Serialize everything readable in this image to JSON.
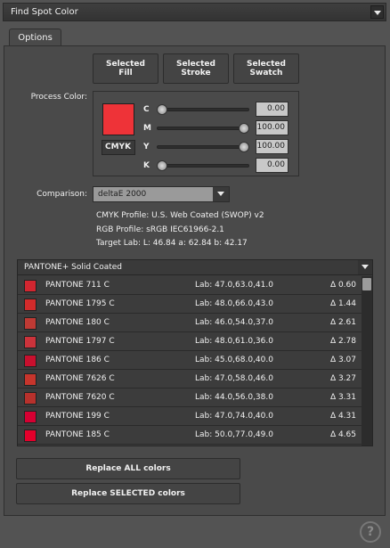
{
  "window": {
    "title": "Find Spot Color"
  },
  "tabs": [
    {
      "label": "Options"
    }
  ],
  "selected_buttons": {
    "fill": "Selected\nFill",
    "stroke": "Selected\nStroke",
    "swatch": "Selected\nSwatch"
  },
  "process_color": {
    "label": "Process Color:",
    "swatch_color": "#ee3338",
    "mode_button": "CMYK",
    "channels": [
      {
        "name": "C",
        "value": "0.00",
        "fraction": 0.0
      },
      {
        "name": "M",
        "value": "100.00",
        "fraction": 1.0
      },
      {
        "name": "Y",
        "value": "100.00",
        "fraction": 1.0
      },
      {
        "name": "K",
        "value": "0.00",
        "fraction": 0.0
      }
    ]
  },
  "comparison": {
    "label": "Comparison:",
    "selected": "deltaE 2000"
  },
  "info": {
    "cmyk_profile": "CMYK Profile: U.S. Web Coated (SWOP) v2",
    "rgb_profile": "RGB Profile: sRGB IEC61966-2.1",
    "target_lab": "Target Lab: L: 46.84 a: 62.84 b: 42.17"
  },
  "library": {
    "name": "PANTONE+ Solid Coated",
    "rows": [
      {
        "name": "PANTONE 711 C",
        "lab": "Lab: 47.0,63.0,41.0",
        "delta": "Δ 0.60",
        "color": "#d22630"
      },
      {
        "name": "PANTONE 1795 C",
        "lab": "Lab: 48.0,66.0,43.0",
        "delta": "Δ 1.44",
        "color": "#d22b2b"
      },
      {
        "name": "PANTONE 180 C",
        "lab": "Lab: 46.0,54.0,37.0",
        "delta": "Δ 2.61",
        "color": "#be3a34"
      },
      {
        "name": "PANTONE 1797 C",
        "lab": "Lab: 48.0,61.0,36.0",
        "delta": "Δ 2.78",
        "color": "#cb333b"
      },
      {
        "name": "PANTONE 186 C",
        "lab": "Lab: 45.0,68.0,40.0",
        "delta": "Δ 3.07",
        "color": "#c8102e"
      },
      {
        "name": "PANTONE 7626 C",
        "lab": "Lab: 47.0,58.0,46.0",
        "delta": "Δ 3.27",
        "color": "#c6352c"
      },
      {
        "name": "PANTONE 7620 C",
        "lab": "Lab: 44.0,56.0,38.0",
        "delta": "Δ 3.31",
        "color": "#b7312c"
      },
      {
        "name": "PANTONE 199 C",
        "lab": "Lab: 47.0,74.0,40.0",
        "delta": "Δ 4.31",
        "color": "#d50032"
      },
      {
        "name": "PANTONE 185 C",
        "lab": "Lab: 50.0,77.0,49.0",
        "delta": "Δ 4.65",
        "color": "#e4002b"
      }
    ]
  },
  "actions": {
    "replace_all": "Replace ALL colors",
    "replace_selected": "Replace SELECTED colors"
  },
  "help": {
    "label": "?"
  }
}
